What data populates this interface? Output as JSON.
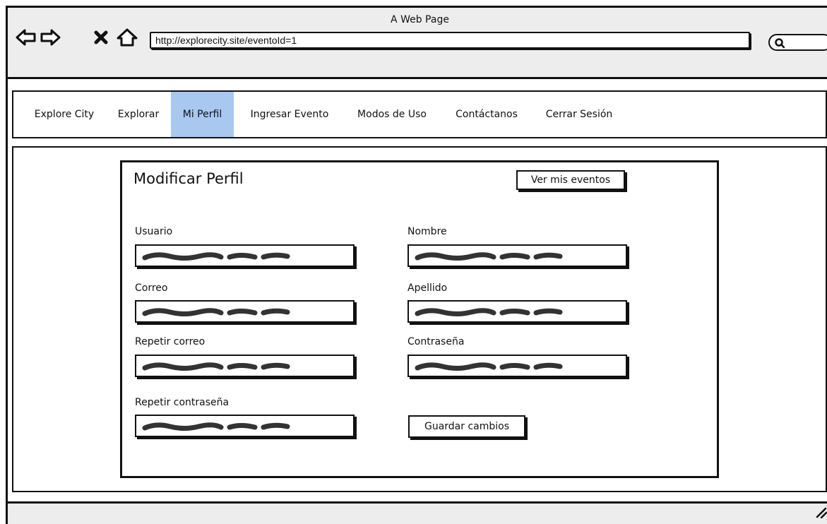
{
  "window": {
    "title": "A Web Page"
  },
  "browser": {
    "url": "http://explorecity.site/eventoId=1"
  },
  "navbar": {
    "items": [
      {
        "label": "Explore City"
      },
      {
        "label": "Explorar"
      },
      {
        "label": "Mi Perfil"
      },
      {
        "label": "Ingresar Evento"
      },
      {
        "label": "Modos de Uso"
      },
      {
        "label": "Contáctanos"
      },
      {
        "label": "Cerrar Sesión"
      }
    ],
    "active": "Mi Perfil"
  },
  "form": {
    "title": "Modificar Perfil",
    "view_events_label": "Ver mis eventos",
    "fields": [
      {
        "label": "Usuario"
      },
      {
        "label": "Nombre"
      },
      {
        "label": "Correo"
      },
      {
        "label": "Apellido"
      },
      {
        "label": "Repetir correo"
      },
      {
        "label": "Contraseña"
      },
      {
        "label": "Repetir contraseña"
      }
    ],
    "save_label": "Guardar cambios"
  },
  "colors": {
    "active_tab": "#a8c8f0",
    "chrome": "#ededed"
  },
  "icons": {
    "back": "back-arrow-icon",
    "forward": "forward-arrow-icon",
    "stop": "close-icon",
    "home": "home-icon",
    "search": "search-icon",
    "resize": "resize-grip-icon"
  }
}
